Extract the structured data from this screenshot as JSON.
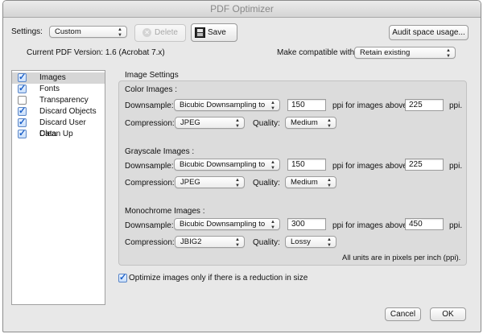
{
  "window": {
    "title": "PDF Optimizer"
  },
  "toolbar": {
    "settings_label": "Settings:",
    "settings_value": "Custom",
    "delete_label": "Delete",
    "save_label": "Save",
    "audit_label": "Audit space usage..."
  },
  "version": {
    "text": "Current PDF Version: 1.6 (Acrobat 7.x)",
    "compat_label": "Make compatible with:",
    "compat_value": "Retain existing"
  },
  "sidebar": {
    "items": [
      {
        "label": "Images",
        "checked": true,
        "selected": true
      },
      {
        "label": "Fonts",
        "checked": true,
        "selected": false
      },
      {
        "label": "Transparency",
        "checked": false,
        "selected": false
      },
      {
        "label": "Discard Objects",
        "checked": true,
        "selected": false
      },
      {
        "label": "Discard User Data",
        "checked": true,
        "selected": false
      },
      {
        "label": "Clean Up",
        "checked": true,
        "selected": false
      }
    ]
  },
  "image_settings": {
    "title": "Image Settings",
    "downsample_label": "Downsample:",
    "compression_label": "Compression:",
    "quality_label": "Quality:",
    "ppi_above_label": "ppi for images above",
    "ppi_label": "ppi.",
    "color": {
      "heading": "Color Images :",
      "downsample": "Bicubic Downsampling to",
      "ppi": "150",
      "above": "225",
      "compression": "JPEG",
      "quality": "Medium"
    },
    "grayscale": {
      "heading": "Grayscale Images :",
      "downsample": "Bicubic Downsampling to",
      "ppi": "150",
      "above": "225",
      "compression": "JPEG",
      "quality": "Medium"
    },
    "mono": {
      "heading": "Monochrome Images :",
      "downsample": "Bicubic Downsampling to",
      "ppi": "300",
      "above": "450",
      "compression": "JBIG2",
      "quality": "Lossy"
    },
    "units_note": "All units are in pixels per inch (ppi)."
  },
  "optimize": {
    "label": "Optimize images only if there is a reduction in size",
    "checked": true
  },
  "footer": {
    "cancel_label": "Cancel",
    "ok_label": "OK"
  },
  "colors": {
    "check_blue": "#1a5fc8",
    "window_bg": "#e8e8e8"
  }
}
